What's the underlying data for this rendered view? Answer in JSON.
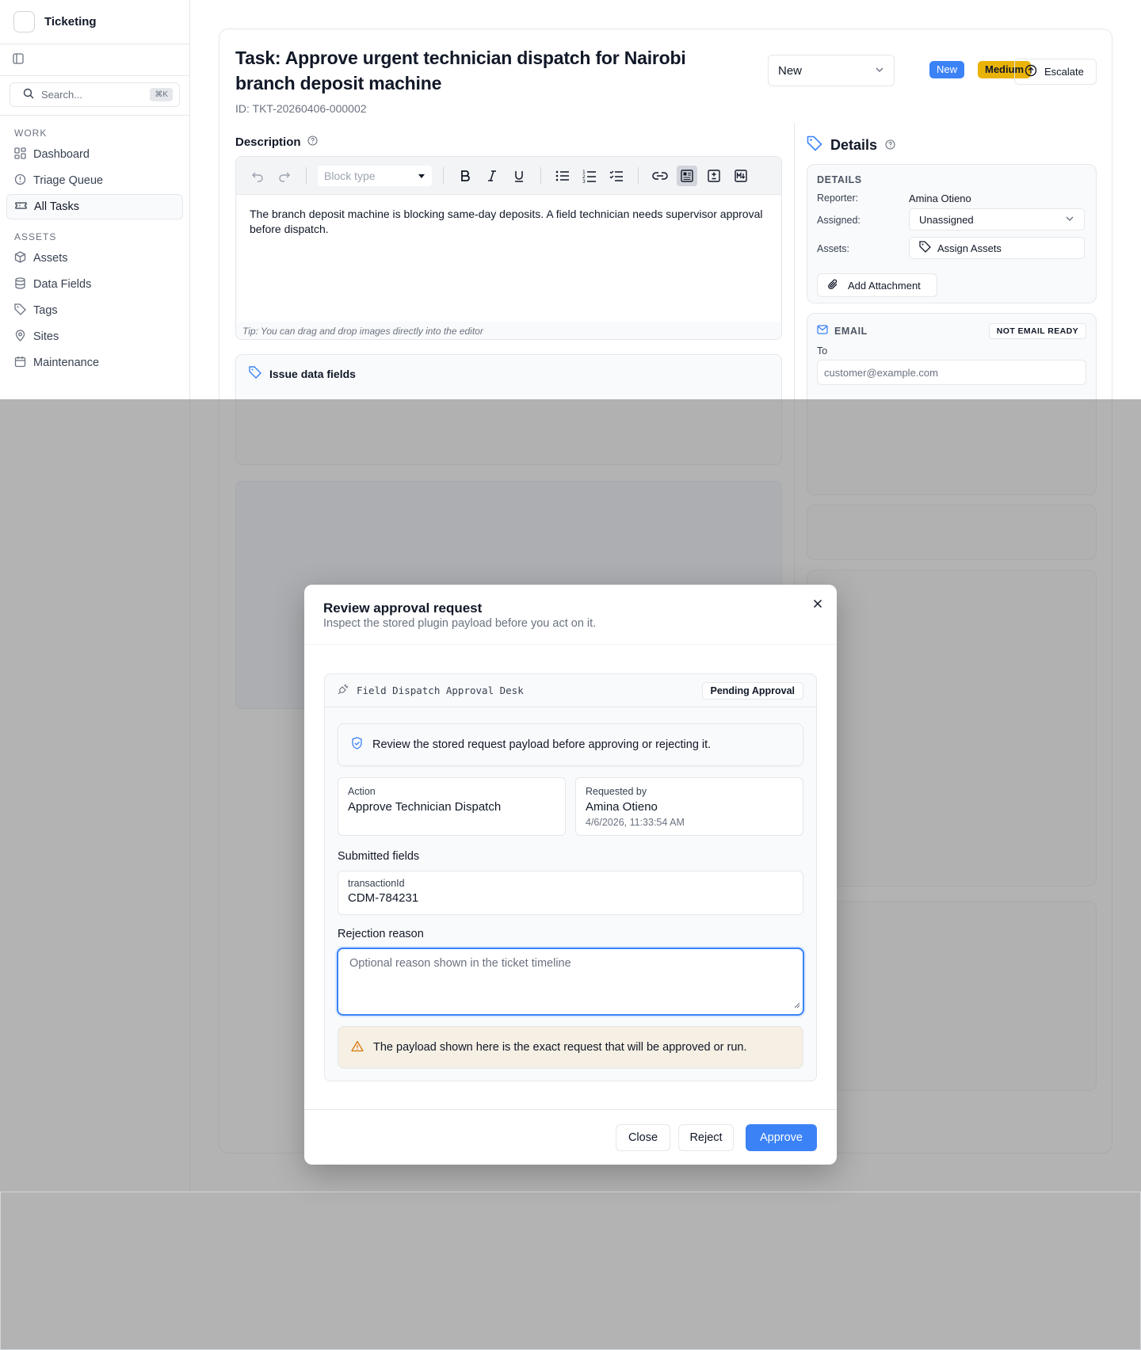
{
  "app": {
    "name": "Ticketing"
  },
  "sidebar": {
    "search_placeholder": "Search...",
    "search_shortcut": "⌘K",
    "sections": [
      {
        "label": "WORK",
        "items": [
          {
            "label": "Dashboard",
            "icon": "dashboard-icon"
          },
          {
            "label": "Triage Queue",
            "icon": "alert-circle-icon"
          },
          {
            "label": "All Tasks",
            "icon": "ticket-icon",
            "active": true
          }
        ]
      },
      {
        "label": "ASSETS",
        "items": [
          {
            "label": "Assets",
            "icon": "box-icon"
          },
          {
            "label": "Data Fields",
            "icon": "database-icon"
          },
          {
            "label": "Tags",
            "icon": "tag-icon"
          },
          {
            "label": "Sites",
            "icon": "map-pin-icon"
          },
          {
            "label": "Maintenance",
            "icon": "calendar-icon"
          }
        ]
      }
    ]
  },
  "task": {
    "title": "Task: Approve urgent technician dispatch for Nairobi branch deposit machine",
    "id": "ID: TKT-20260406-000002",
    "status_value": "New",
    "status_badge": "New",
    "priority_badge": "Medium",
    "escalate_label": "Escalate",
    "colors": {
      "new_badge": "#3b82f6",
      "medium_badge": "#eab308",
      "accent": "#3b82f6"
    }
  },
  "description": {
    "label": "Description",
    "block_type_placeholder": "Block type",
    "body": "The branch deposit machine is blocking same-day deposits. A field technician needs supervisor approval before dispatch.",
    "tip": "Tip: You can drag and drop images directly into the editor"
  },
  "issue": {
    "title": "Issue data fields"
  },
  "details": {
    "heading": "Details",
    "section_label": "DETAILS",
    "reporter_label": "Reporter:",
    "reporter_value": "Amina Otieno",
    "assigned_label": "Assigned:",
    "assigned_value": "Unassigned",
    "assets_label": "Assets:",
    "assets_button": "Assign Assets",
    "attachment_button": "Add Attachment"
  },
  "email": {
    "label": "EMAIL",
    "badge": "NOT EMAIL READY",
    "to_label": "To",
    "to_placeholder": "customer@example.com"
  },
  "modal": {
    "title": "Review approval request",
    "subtitle": "Inspect the stored plugin payload before you act on it.",
    "desk_name": "Field Dispatch Approval Desk",
    "status": "Pending Approval",
    "info": "Review the stored request payload before approving or rejecting it.",
    "action_label": "Action",
    "action_value": "Approve Technician Dispatch",
    "requested_by_label": "Requested by",
    "requested_by_value": "Amina Otieno",
    "requested_at": "4/6/2026, 11:33:54 AM",
    "submitted_heading": "Submitted fields",
    "field_key": "transactionId",
    "field_value": "CDM-784231",
    "rejection_heading": "Rejection reason",
    "rejection_placeholder": "Optional reason shown in the ticket timeline",
    "warning": "The payload shown here is the exact request that will be approved or run.",
    "close_label": "Close",
    "reject_label": "Reject",
    "approve_label": "Approve"
  }
}
